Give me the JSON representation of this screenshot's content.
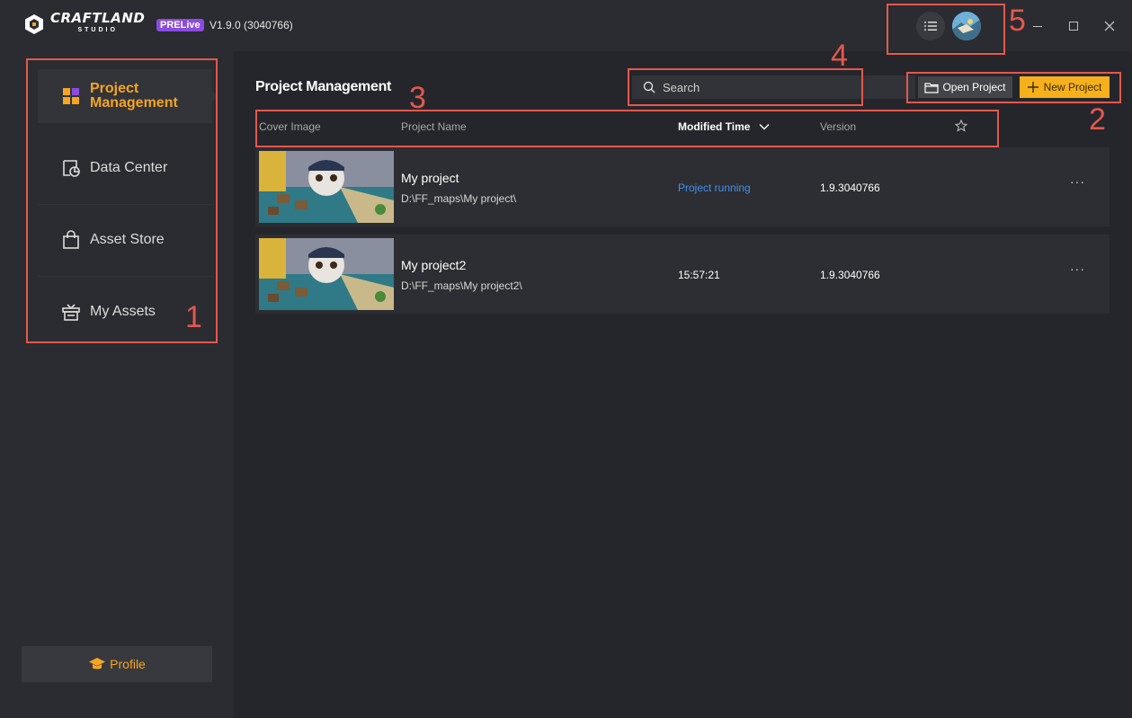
{
  "app": {
    "logo_main": "CRAFTLAND",
    "logo_sub": "STUDIO",
    "badge": "PRELive",
    "version": "V1.9.0 (3040766)"
  },
  "sidebar": {
    "items": [
      {
        "label": "Project Management",
        "icon": "grid-icon",
        "active": true
      },
      {
        "label": "Data Center",
        "icon": "chart-icon"
      },
      {
        "label": "Asset Store",
        "icon": "shopping-bag-icon"
      },
      {
        "label": "My Assets",
        "icon": "gift-box-icon"
      }
    ],
    "profile_label": "Profile"
  },
  "main": {
    "title": "Project Management",
    "search_placeholder": "Search",
    "open_project_label": "Open Project",
    "new_project_label": "New Project",
    "columns": {
      "cover": "Cover Image",
      "name": "Project Name",
      "modified": "Modified Time",
      "version": "Version"
    },
    "projects": [
      {
        "name": "My project",
        "path": "D:\\FF_maps\\My project\\",
        "modified": "Project running",
        "version": "1.9.3040766",
        "more": "···"
      },
      {
        "name": "My project2",
        "path": "D:\\FF_maps\\My project2\\",
        "modified": "15:57:21",
        "version": "1.9.3040766",
        "more": "···"
      }
    ]
  },
  "annotations": [
    "1",
    "2",
    "3",
    "4",
    "5"
  ],
  "colors": {
    "accent": "#f5a524",
    "running": "#3f8ff0",
    "annotation": "#e4584d",
    "badge": "#8a4be0"
  }
}
